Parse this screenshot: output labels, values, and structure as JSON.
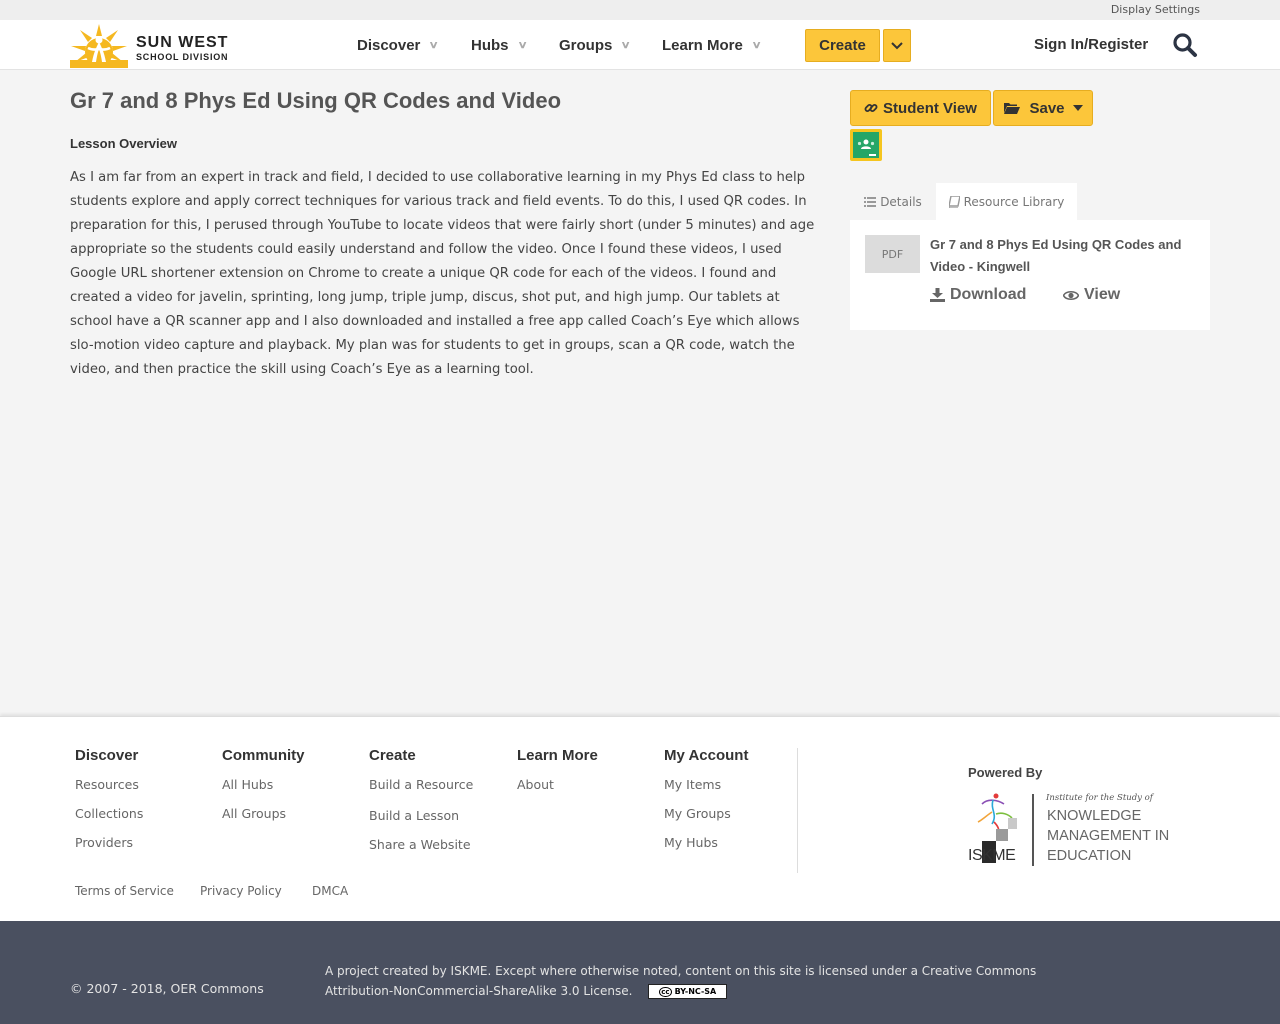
{
  "topbar": {
    "display_settings": "Display Settings"
  },
  "header": {
    "logo_line1": "SUN WEST",
    "logo_line2": "SCHOOL DIVISION",
    "nav": [
      {
        "label": "Discover"
      },
      {
        "label": "Hubs"
      },
      {
        "label": "Groups"
      },
      {
        "label": "Learn More"
      }
    ],
    "create_label": "Create",
    "signin_label": "Sign In/Register"
  },
  "main": {
    "title": "Gr 7 and 8 Phys Ed Using QR Codes and Video",
    "overview_label": "Lesson Overview",
    "overview_text": "As I am far from an expert in track and field, I decided to use collaborative learning in my Phys Ed class to help students explore and apply correct techniques for various track and field events.  To do this, I used QR codes.  In preparation for this, I perused through YouTube to locate videos that were fairly short (under 5 minutes) and age appropriate so the students could easily understand and follow the video.  Once I found these videos, I used Google URL shortener extension on Chrome to create a unique QR code for each of the videos.  I found and created a video for javelin, sprinting, long jump, triple jump, discus, shot put, and high jump.  Our tablets at school have a QR scanner app and I also downloaded and installed a free app called Coach’s Eye which allows slo-motion video capture and playback.  My plan was for students to get in groups, scan a QR code, watch the video, and then practice the skill using Coach’s Eye as a learning tool."
  },
  "sidebar": {
    "student_view_label": "Student View",
    "save_label": "Save",
    "tabs": [
      {
        "label": "Details"
      },
      {
        "label": "Resource Library"
      }
    ],
    "resource": {
      "badge": "PDF",
      "title": "Gr 7 and 8 Phys Ed Using QR Codes and Video - Kingwell",
      "download_label": "Download",
      "view_label": "View"
    }
  },
  "footer": {
    "columns": [
      {
        "heading": "Discover",
        "links": [
          "Resources",
          "Collections",
          "Providers"
        ]
      },
      {
        "heading": "Community",
        "links": [
          "All Hubs",
          "All Groups"
        ]
      },
      {
        "heading": "Create",
        "links": [
          "Build a Resource",
          "Build a Lesson",
          "Share a Website"
        ]
      },
      {
        "heading": "Learn More",
        "links": [
          "About"
        ]
      },
      {
        "heading": "My Account",
        "links": [
          "My Items",
          "My Groups",
          "My Hubs"
        ]
      }
    ],
    "powered_by": "Powered By",
    "iskme_lines": [
      "Institute for the Study of",
      "KNOWLEDGE",
      "MANAGEMENT IN",
      "EDUCATION"
    ],
    "iskme_mark": "ISKME",
    "legal": [
      "Terms of Service",
      "Privacy Policy",
      "DMCA"
    ]
  },
  "bottombar": {
    "copyright": "© 2007 - 2018, OER Commons",
    "license": "A project created by ISKME. Except where otherwise noted, content on this site is licensed under a Creative Commons Attribution-NonCommercial-ShareAlike 3.0 License.",
    "cc_badge": "BY-NC-SA"
  },
  "colors": {
    "accent_yellow": "#fcc63a",
    "bottom_bar": "#4a5060",
    "classroom_green": "#25a667"
  }
}
